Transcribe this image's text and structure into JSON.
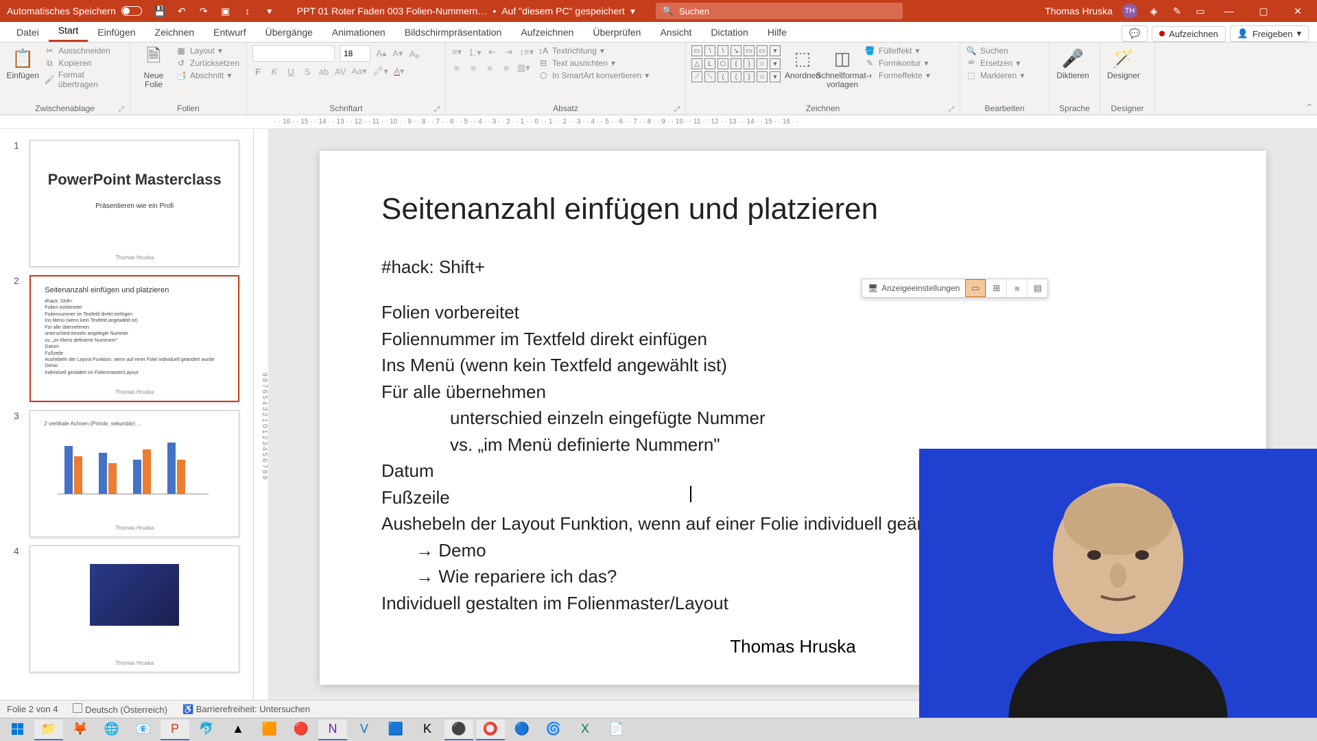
{
  "titlebar": {
    "autosave": "Automatisches Speichern",
    "doc_title": "PPT 01 Roter Faden 003 Folien-Nummern…",
    "saved_status": "Auf \"diesem PC\" gespeichert",
    "search_placeholder": "Suchen",
    "user_name": "Thomas Hruska",
    "user_initials": "TH"
  },
  "tabs": {
    "file": "Datei",
    "home": "Start",
    "insert": "Einfügen",
    "draw": "Zeichnen",
    "design": "Entwurf",
    "transitions": "Übergänge",
    "animations": "Animationen",
    "slideshow": "Bildschirmpräsentation",
    "record_tab": "Aufzeichnen",
    "review": "Überprüfen",
    "view": "Ansicht",
    "dictation_tab": "Dictation",
    "help": "Hilfe",
    "record_btn": "Aufzeichnen",
    "share": "Freigeben"
  },
  "ribbon": {
    "clipboard": {
      "paste": "Einfügen",
      "cut": "Ausschneiden",
      "copy": "Kopieren",
      "format_painter": "Format übertragen",
      "label": "Zwischenablage"
    },
    "slides": {
      "new_slide": "Neue Folie",
      "layout": "Layout",
      "reset": "Zurücksetzen",
      "section": "Abschnitt",
      "label": "Folien"
    },
    "font": {
      "size": "18",
      "label": "Schriftart"
    },
    "paragraph": {
      "text_direction": "Textrichtung",
      "align_text": "Text ausrichten",
      "convert_smartart": "In SmartArt konvertieren",
      "label": "Absatz"
    },
    "drawing": {
      "arrange": "Anordnen",
      "quick_styles": "Schnellformat-vorlagen",
      "shape_fill": "Fülleffekt",
      "shape_outline": "Formkontur",
      "shape_effects": "Formeffekte",
      "label": "Zeichnen"
    },
    "editing": {
      "find": "Suchen",
      "replace": "Ersetzen",
      "select": "Markieren",
      "label": "Bearbeiten"
    },
    "voice": {
      "dictate": "Diktieren",
      "label": "Sprache"
    },
    "designer": {
      "btn": "Designer",
      "label": "Designer"
    }
  },
  "thumbs": {
    "s1": {
      "title": "PowerPoint Masterclass",
      "sub": "Präsentieren wie ein Profi",
      "author": "Thomas Hruska"
    },
    "s2": {
      "title": "Seitenanzahl einfügen und platzieren",
      "author": "Thomas Hruska",
      "lines": [
        "#hack: Shift+",
        "Folien vorbereitet",
        "Foliennummer im Textfeld direkt einfügen",
        "Ins Menü (wenn kein Textfeld angewählt ist)",
        "Für alle übernehmen",
        "unterschied einzeln angelegte Nummer",
        "vs. „im Menü definierte Nummern\"",
        "Datum",
        "Fußzeile",
        "Aushebeln der Layout Funktion, wenn auf einer Folie individuell geändert wurde",
        "Demo",
        "Individuell gestalten im Folienmaster/Layout"
      ]
    },
    "s3": {
      "author": "Thomas Hruska"
    },
    "s4": {
      "author": "Thomas Hruska"
    }
  },
  "slide": {
    "title": "Seitenanzahl einfügen und platzieren",
    "hack": "#hack: Shift+",
    "l1": "Folien vorbereitet",
    "l2": "Foliennummer im Textfeld direkt einfügen",
    "l3": "Ins Menü (wenn kein Textfeld angewählt ist)",
    "l4": "Für alle übernehmen",
    "l5": "unterschied  einzeln eingefügte Nummer",
    "l6": "vs. „im Menü definierte Nummern\"",
    "l7": "Datum",
    "l8": "Fußzeile",
    "l9": "Aushebeln der Layout Funktion, wenn auf einer Folie individuell geändert",
    "l10": "→ Demo",
    "l11": "→ Wie repariere ich das?",
    "l12": "Individuell gestalten im Folienmaster/Layout",
    "author": "Thomas Hruska"
  },
  "mini_toolbar": {
    "display_settings": "Anzeigeeinstellungen"
  },
  "status": {
    "slide_info": "Folie 2 von 4",
    "language": "Deutsch (Österreich)",
    "a11y": "Barrierefreiheit: Untersuchen"
  }
}
